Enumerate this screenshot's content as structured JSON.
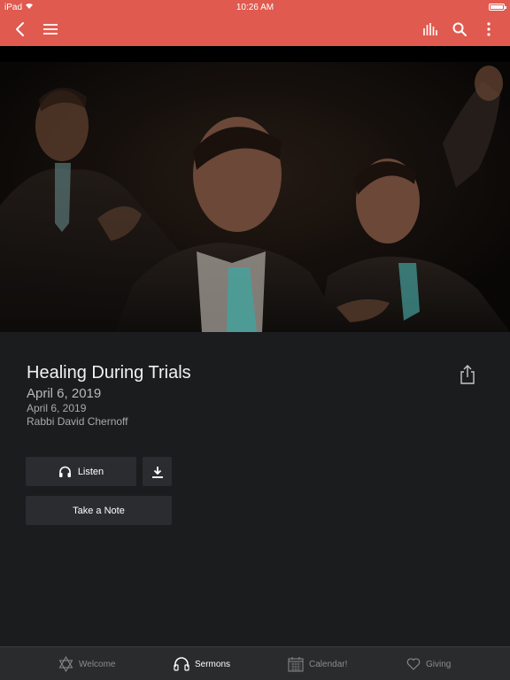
{
  "status": {
    "carrier": "iPad",
    "time": "10:26 AM"
  },
  "nav": {
    "icons": [
      "back-chevron-icon",
      "hamburger-menu-icon",
      "audio-bars-icon",
      "search-icon",
      "more-vertical-icon"
    ]
  },
  "sermon": {
    "title": "Healing During Trials",
    "date_large": "April 6, 2019",
    "date_small": "April 6, 2019",
    "speaker": "Rabbi David Chernoff"
  },
  "actions": {
    "listen_label": "Listen",
    "note_label": "Take a Note"
  },
  "tabs": [
    {
      "label": "Welcome",
      "icon": "star-of-david-icon",
      "active": false
    },
    {
      "label": "Sermons",
      "icon": "headphones-icon",
      "active": true
    },
    {
      "label": "Calendar!",
      "icon": "calendar-icon",
      "active": false
    },
    {
      "label": "Giving",
      "icon": "heart-icon",
      "active": false
    }
  ],
  "colors": {
    "accent": "#e05a4f",
    "background": "#1b1c1e",
    "button": "#2b2c2f",
    "tabbar": "#2a2b2d"
  }
}
